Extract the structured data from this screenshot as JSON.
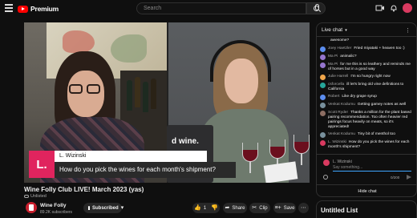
{
  "header": {
    "logo_text": "Premium",
    "search_placeholder": "Search"
  },
  "video": {
    "laptop_sticker": "d wine.",
    "overlay": {
      "avatar_letter": "L.",
      "name": "L. Wizinski",
      "question": "How do you pick the wines for each month's shipment?"
    }
  },
  "meta": {
    "title": "Wine Folly Club LIVE! March 2023 (yas)",
    "visibility": "Unlisted",
    "channel": "Wine Folly",
    "subscribers": "89.2K subscribers",
    "subscribed_label": "Subscribed",
    "likes": "1",
    "share_label": "Share",
    "clip_label": "Clip",
    "save_label": "Save"
  },
  "chat": {
    "header": "Live chat",
    "messages": [
      {
        "author": "",
        "text": "awesome?",
        "color": "#0f0f0f"
      },
      {
        "author": "Joey Haetzler",
        "text": "Fried miyataki + heaven too :)",
        "color": "#5b8def"
      },
      {
        "author": "Ma Pi",
        "text": "animalic?",
        "color": "#9575cd"
      },
      {
        "author": "Ma Pi",
        "text": "for me this is so leathery and reminds me of horses but in a good way",
        "color": "#9575cd"
      },
      {
        "author": "Julie Harrell",
        "text": "I'm so hungry right now",
        "color": "#f0a64b"
      },
      {
        "author": "csforcella",
        "text": "ill let's bring old vine definitions to California",
        "color": "#26a69a"
      },
      {
        "author": "Robert",
        "text": "Like dry grape syrup",
        "color": "#5b8def"
      },
      {
        "author": "Venkat Kodumu",
        "text": "Getting gamey notes as well",
        "color": "#78909c"
      },
      {
        "author": "Scott Ryder",
        "text": "Thanks a million for the plant based pairing recommendation. Too often heavier red pairings focus heavily on meats, so it's appreciated!",
        "color": "#8d6e63"
      },
      {
        "author": "Venkat Kodumu",
        "text": "Tiny bit of menthol too",
        "color": "#78909c"
      },
      {
        "author": "L. Wizinski",
        "text": "How do you pick the wines for each month's shipment?",
        "color": "#d93a60"
      }
    ],
    "me_name": "L. Wizinski",
    "input_placeholder": "Say something...",
    "counter": "0/200",
    "hide_label": "Hide chat"
  },
  "sidebar": {
    "next_title": "Untitled List"
  }
}
